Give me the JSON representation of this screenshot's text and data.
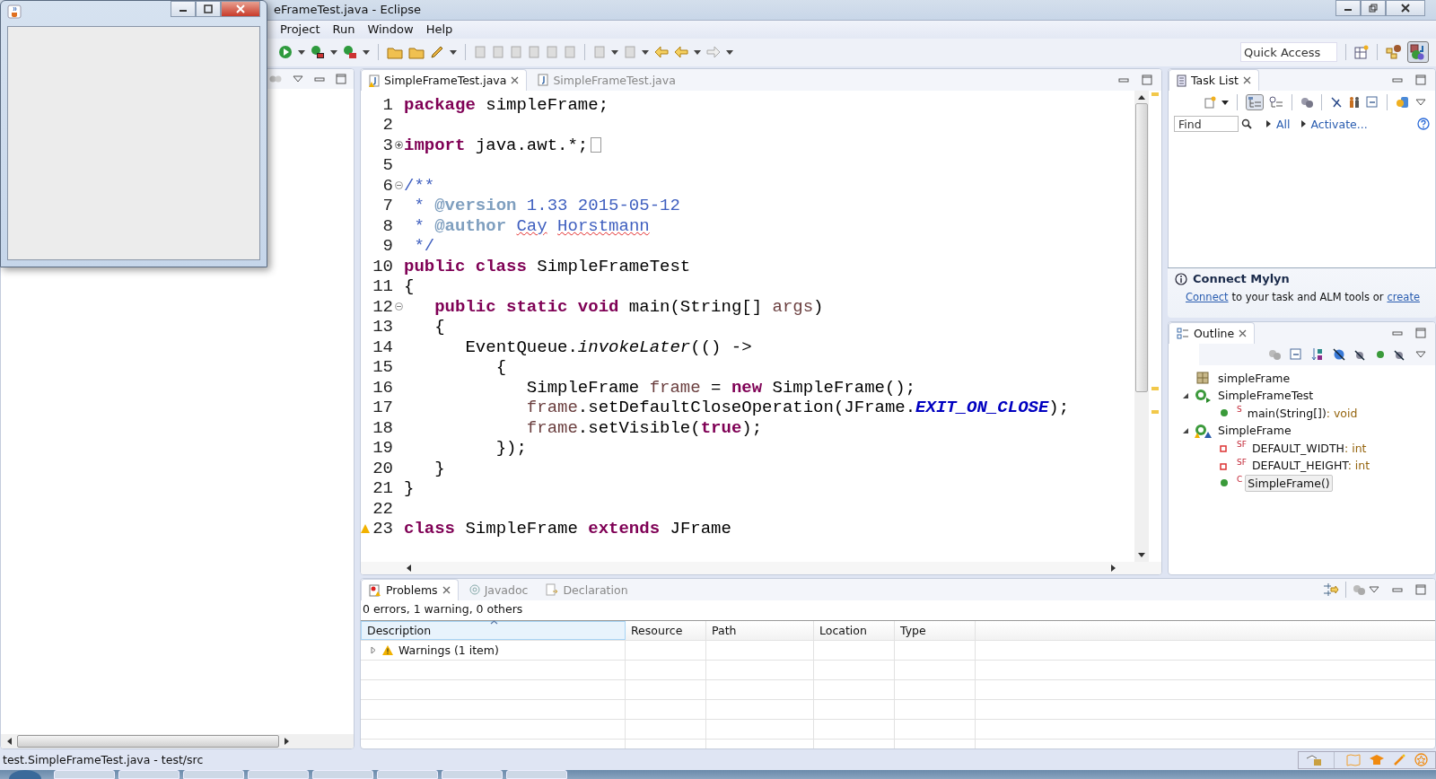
{
  "window": {
    "title": "eFrameTest.java - Eclipse"
  },
  "menu": [
    "Project",
    "Run",
    "Window",
    "Help"
  ],
  "quick_access": {
    "placeholder": "Quick Access"
  },
  "editor": {
    "tabs": [
      {
        "label": "SimpleFrameTest.java",
        "selected": true,
        "closable": true,
        "warning": true
      },
      {
        "label": "SimpleFrameTest.java",
        "selected": false,
        "closable": false,
        "warning": false
      }
    ],
    "lines": [
      {
        "number": "1",
        "tokens": [
          {
            "kind": "keyword",
            "text": "package"
          },
          {
            "kind": "plain",
            "text": " simpleFrame;"
          }
        ]
      },
      {
        "number": "2"
      },
      {
        "number": "3",
        "collapsed": true,
        "folded_box": true,
        "tokens": [
          {
            "kind": "keyword",
            "text": "import"
          },
          {
            "kind": "plain",
            "text": " java.awt.*;"
          }
        ]
      },
      {
        "number": "5"
      },
      {
        "number": "6",
        "collapsed": false,
        "tokens": [
          {
            "kind": "comment",
            "text": "/**"
          }
        ]
      },
      {
        "number": "7",
        "tokens": [
          {
            "kind": "comment",
            "text": " * "
          },
          {
            "kind": "tag",
            "text": "@version"
          },
          {
            "kind": "comment",
            "text": " 1.33 2015-05-12"
          }
        ]
      },
      {
        "number": "8",
        "tokens": [
          {
            "kind": "comment",
            "text": " * "
          },
          {
            "kind": "tag",
            "text": "@author"
          },
          {
            "kind": "comment",
            "text": " Cay",
            "misspelled": true
          },
          {
            "kind": "comment",
            "text": " Horstmann",
            "misspelled": true
          }
        ]
      },
      {
        "number": "9",
        "tokens": [
          {
            "kind": "comment",
            "text": " */"
          }
        ]
      },
      {
        "number": "10",
        "tokens": [
          {
            "kind": "keyword",
            "text": "public class"
          },
          {
            "kind": "plain",
            "text": " SimpleFrameTest"
          }
        ]
      },
      {
        "number": "11",
        "tokens": [
          {
            "kind": "plain",
            "text": "{"
          }
        ]
      },
      {
        "number": "12",
        "collapsed": false,
        "tokens": [
          {
            "kind": "keyword",
            "text": "   public static void"
          },
          {
            "kind": "plain",
            "text": " main(String[] "
          },
          {
            "kind": "local",
            "text": "args"
          },
          {
            "kind": "plain",
            "text": ")"
          }
        ]
      },
      {
        "number": "13",
        "tokens": [
          {
            "kind": "plain",
            "text": "   {"
          }
        ]
      },
      {
        "number": "14",
        "tokens": [
          {
            "kind": "plain",
            "text": "      EventQueue."
          },
          {
            "kind": "static",
            "text": "invokeLater"
          },
          {
            "kind": "plain",
            "text": "(() ->"
          }
        ]
      },
      {
        "number": "15",
        "tokens": [
          {
            "kind": "plain",
            "text": "         {"
          }
        ]
      },
      {
        "number": "16",
        "tokens": [
          {
            "kind": "plain",
            "text": "            SimpleFrame "
          },
          {
            "kind": "local",
            "text": "frame"
          },
          {
            "kind": "plain",
            "text": " = "
          },
          {
            "kind": "keyword",
            "text": "new"
          },
          {
            "kind": "plain",
            "text": " SimpleFrame();"
          }
        ]
      },
      {
        "number": "17",
        "tokens": [
          {
            "kind": "local",
            "text": "            frame"
          },
          {
            "kind": "plain",
            "text": ".setDefaultCloseOperation(JFrame."
          },
          {
            "kind": "constant",
            "text": "EXIT_ON_CLOSE"
          },
          {
            "kind": "plain",
            "text": ");"
          }
        ]
      },
      {
        "number": "18",
        "tokens": [
          {
            "kind": "local",
            "text": "            frame"
          },
          {
            "kind": "plain",
            "text": ".setVisible("
          },
          {
            "kind": "keyword",
            "text": "true"
          },
          {
            "kind": "plain",
            "text": ");"
          }
        ]
      },
      {
        "number": "19",
        "tokens": [
          {
            "kind": "plain",
            "text": "         });"
          }
        ]
      },
      {
        "number": "20",
        "tokens": [
          {
            "kind": "plain",
            "text": "   }"
          }
        ]
      },
      {
        "number": "21",
        "tokens": [
          {
            "kind": "plain",
            "text": "}"
          }
        ]
      },
      {
        "number": "22"
      },
      {
        "number": "23",
        "warning": true,
        "tokens": [
          {
            "kind": "keyword",
            "text": "class"
          },
          {
            "kind": "plain",
            "text": " SimpleFrame "
          },
          {
            "kind": "keyword",
            "text": "extends"
          },
          {
            "kind": "plain",
            "text": " JFrame"
          }
        ]
      }
    ]
  },
  "task_list": {
    "tab": "Task List",
    "find": {
      "placeholder": "Find"
    },
    "links": [
      "All",
      "Activate..."
    ]
  },
  "mylyn": {
    "title": "Connect Mylyn",
    "parts": [
      {
        "kind": "link",
        "text": "Connect"
      },
      {
        "kind": "text",
        "text": "to your task and ALM tools or"
      },
      {
        "kind": "link",
        "text": "create"
      }
    ]
  },
  "outline": {
    "tab": "Outline",
    "items": [
      {
        "kind": "package",
        "label": "simpleFrame",
        "selected": false
      },
      {
        "kind": "class",
        "runnable": true,
        "warning": false,
        "label": "SimpleFrameTest",
        "selected": false,
        "expanded": true,
        "children": [
          {
            "kind": "method",
            "decorator": "S",
            "label": "main(String[])",
            "type": ": void",
            "selected": false
          }
        ]
      },
      {
        "kind": "class",
        "runnable": false,
        "warning": true,
        "label": "SimpleFrame",
        "selected": false,
        "expanded": true,
        "children": [
          {
            "kind": "field",
            "decorator": "SF",
            "label": "DEFAULT_WIDTH",
            "type": ": int",
            "selected": false
          },
          {
            "kind": "field",
            "decorator": "SF",
            "label": "DEFAULT_HEIGHT",
            "type": ": int",
            "selected": false
          },
          {
            "kind": "method",
            "decorator": "C",
            "label": "SimpleFrame()",
            "selected": true
          }
        ]
      }
    ]
  },
  "problems": {
    "tabs": [
      {
        "label": "Problems",
        "selected": true
      },
      {
        "label": "Javadoc",
        "selected": false
      },
      {
        "label": "Declaration",
        "selected": false
      }
    ],
    "summary": "0 errors, 1 warning, 0 others",
    "columns": [
      "Description",
      "Resource",
      "Path",
      "Location",
      "Type"
    ],
    "rows": [
      {
        "label": "Warnings (1 item)",
        "expanded": false
      }
    ]
  },
  "status_bar": {
    "text": "test.SimpleFrameTest.java - test/src"
  }
}
